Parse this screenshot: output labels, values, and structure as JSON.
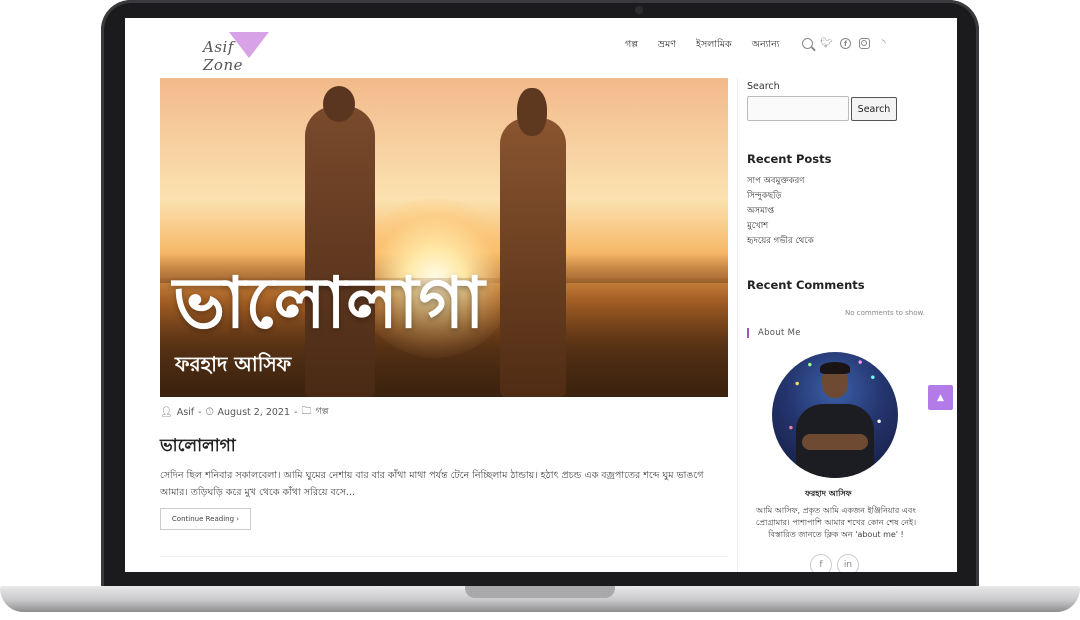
{
  "header": {
    "logo_text": "Asif Zone",
    "nav": [
      "গল্প",
      "ভ্রমণ",
      "ইসলামিক",
      "অন্যান্য"
    ]
  },
  "hero": {
    "title": "ভালোলাগা",
    "subtitle": "ফরহাদ আসিফ"
  },
  "post": {
    "author": "Asif",
    "date": "August 2, 2021",
    "category": "গল্প",
    "title": "ভালোলাগা",
    "excerpt": "সেদিন ছিল শনিবার সকালবেলা। আমি ঘুমের নেশায় বার বার কাঁথা মাথা পর্যন্ত টেনে নিচ্ছিলাম ঠান্ডায়। হঠাৎ প্রচন্ড এক বজ্রপাতের শব্দে ঘুম ভাঙগে আমার। তড়িঘড়ি করে মুখ থেকে কাঁথা সরিয়ে বসে...",
    "read_more": "Continue Reading"
  },
  "sidebar": {
    "search_label": "Search",
    "search_button": "Search",
    "recent_posts_title": "Recent Posts",
    "recent_posts": [
      "সাপ অবমুক্তকরণ",
      "সিন্দুকছড়ি",
      "অসমাপ্ত",
      "মুখোশ",
      "হৃদয়ের গভীর থেকে"
    ],
    "recent_comments_title": "Recent Comments",
    "no_comments": "No comments to show.",
    "about_title": "About Me",
    "about_name": "ফরহাদ আসিফ",
    "about_bio": "আমি আসিফ, প্রকৃত আমি একজন ইঞ্জিনিয়ার এবং প্রোগ্রামার। পাশাপাশি আমার শখের কোন শেষ নেই। বিস্তারিত জানতে ক্লিক অন 'about me' !"
  },
  "colors": {
    "accent": "#b27be8",
    "logo_triangle": "#d7a3e6"
  }
}
